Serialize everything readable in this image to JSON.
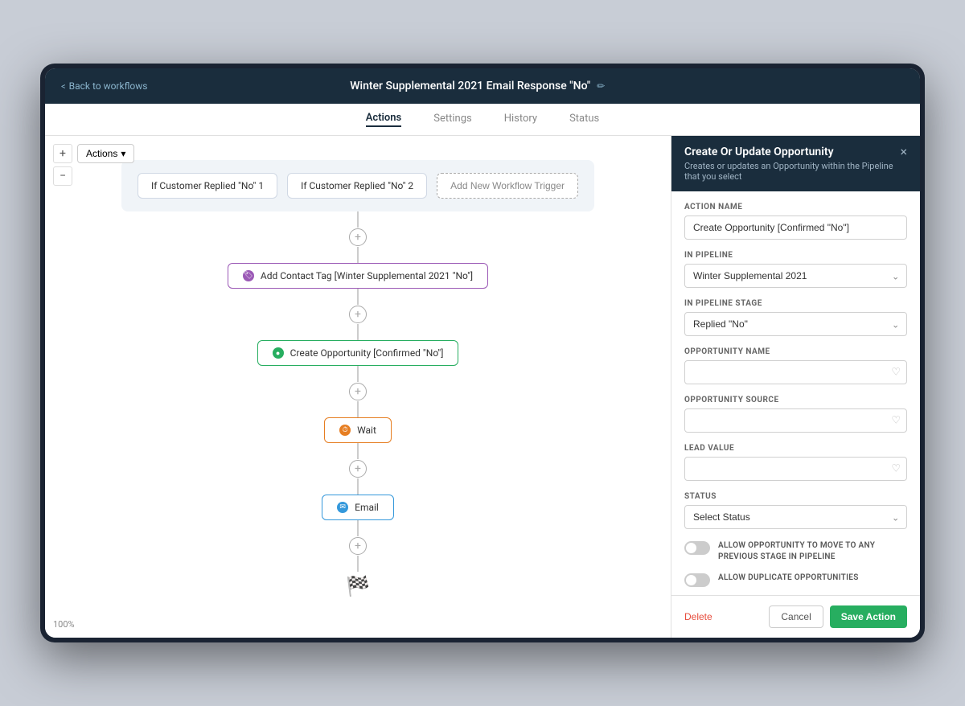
{
  "topbar": {
    "back_label": "Back to workflows",
    "title": "Winter Supplemental 2021 Email Response \"No\"",
    "edit_icon": "✏"
  },
  "tabs": [
    {
      "label": "Actions",
      "active": true
    },
    {
      "label": "Settings",
      "active": false
    },
    {
      "label": "History",
      "active": false
    },
    {
      "label": "Status",
      "active": false
    }
  ],
  "canvas": {
    "zoom": "100%",
    "actions_label": "Actions",
    "triggers": [
      {
        "label": "If Customer Replied \"No\" 1"
      },
      {
        "label": "If Customer Replied \"No\" 2"
      }
    ],
    "add_trigger_label": "Add New Workflow Trigger",
    "nodes": [
      {
        "type": "tag",
        "label": "Add Contact Tag [Winter Supplemental 2021 \"No\"]",
        "icon_type": "purple"
      },
      {
        "type": "opportunity",
        "label": "Create Opportunity [Confirmed \"No\"]",
        "icon_type": "green"
      },
      {
        "type": "wait",
        "label": "Wait",
        "icon_type": "orange"
      },
      {
        "type": "email",
        "label": "Email",
        "icon_type": "blue"
      }
    ]
  },
  "panel": {
    "title": "Create Or Update Opportunity",
    "subtitle": "Creates or updates an Opportunity within the Pipeline that you select",
    "close_icon": "×",
    "fields": {
      "action_name_label": "ACTION NAME",
      "action_name_value": "Create Opportunity [Confirmed \"No\"]",
      "in_pipeline_label": "IN PIPELINE",
      "in_pipeline_value": "Winter Supplemental 2021",
      "in_pipeline_stage_label": "IN PIPELINE STAGE",
      "in_pipeline_stage_value": "Replied \"No\"",
      "opportunity_name_label": "OPPORTUNITY NAME",
      "opportunity_name_value": "",
      "opportunity_source_label": "OPPORTUNITY SOURCE",
      "opportunity_source_value": "",
      "lead_value_label": "LEAD VALUE",
      "lead_value_value": "",
      "status_label": "STATUS",
      "status_value": "Select Status",
      "toggle1_label": "ALLOW OPPORTUNITY TO MOVE TO ANY PREVIOUS STAGE IN PIPELINE",
      "toggle2_label": "ALLOW DUPLICATE OPPORTUNITIES"
    },
    "footer": {
      "delete_label": "Delete",
      "cancel_label": "Cancel",
      "save_label": "Save Action"
    }
  }
}
